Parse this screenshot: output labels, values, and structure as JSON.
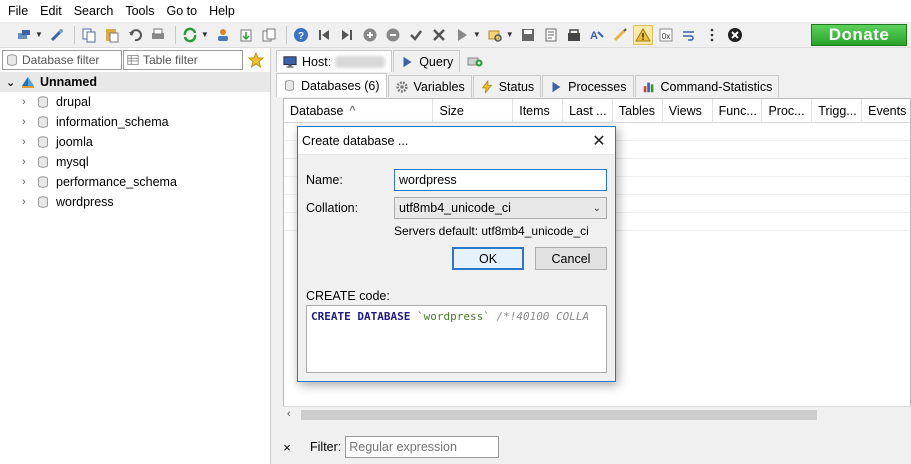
{
  "menu": [
    "File",
    "Edit",
    "Search",
    "Tools",
    "Go to",
    "Help"
  ],
  "toolbar": {
    "donate_label": "Donate"
  },
  "left_panel": {
    "database_filter_placeholder": "Database filter",
    "table_filter_placeholder": "Table filter",
    "root_label": "Unnamed",
    "databases": [
      "drupal",
      "information_schema",
      "joomla",
      "mysql",
      "performance_schema",
      "wordpress"
    ]
  },
  "host_tabs": {
    "host_label": "Host:",
    "query_label": "Query"
  },
  "sub_tabs": [
    "Databases (6)",
    "Variables",
    "Status",
    "Processes",
    "Command-Statistics"
  ],
  "grid": {
    "columns": [
      "Database",
      "Size",
      "Items",
      "Last ...",
      "Tables",
      "Views",
      "Func...",
      "Proc...",
      "Trigg...",
      "Events"
    ],
    "sort_indicator": "^"
  },
  "filter_bar": {
    "close_glyph": "×",
    "label": "Filter:",
    "placeholder": "Regular expression"
  },
  "dialog": {
    "title": "Create database ...",
    "close_glyph": "✕",
    "name_label": "Name:",
    "name_value": "wordpress",
    "collation_label": "Collation:",
    "collation_value": "utf8mb4_unicode_ci",
    "servers_default": "Servers default: utf8mb4_unicode_ci",
    "ok_label": "OK",
    "cancel_label": "Cancel",
    "create_code_label": "CREATE code:",
    "code_keyword": "CREATE DATABASE",
    "code_name": "`wordpress`",
    "code_comment": "/*!40100 COLLA"
  },
  "colors": {
    "accent": "#2b78c8",
    "donate": "#28a428"
  }
}
